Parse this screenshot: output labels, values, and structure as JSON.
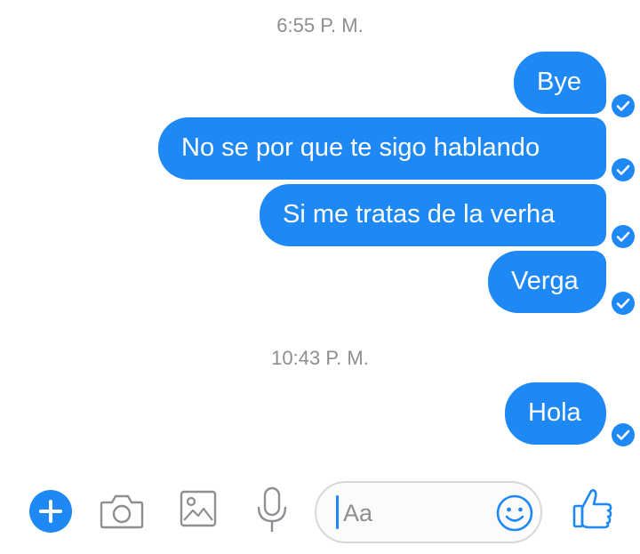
{
  "thread": {
    "timestamp_1": "6:55 P. M.",
    "timestamp_2": "10:43 P. M.",
    "messages": [
      {
        "text": "Bye",
        "status": "sent"
      },
      {
        "text": "No se por que te sigo hablando",
        "status": "sent"
      },
      {
        "text": "Si me tratas de la verha",
        "status": "sent"
      },
      {
        "text": "Verga",
        "status": "sent"
      },
      {
        "text": "Hola",
        "status": "sent"
      }
    ]
  },
  "composer": {
    "placeholder": "Aa",
    "icons": [
      "plus-icon",
      "camera-icon",
      "gallery-icon",
      "microphone-icon",
      "emoji-icon",
      "thumbs-up-icon"
    ]
  },
  "colors": {
    "accent": "#1e88f5",
    "muted_text": "#8e8e93",
    "background": "#ffffff"
  }
}
